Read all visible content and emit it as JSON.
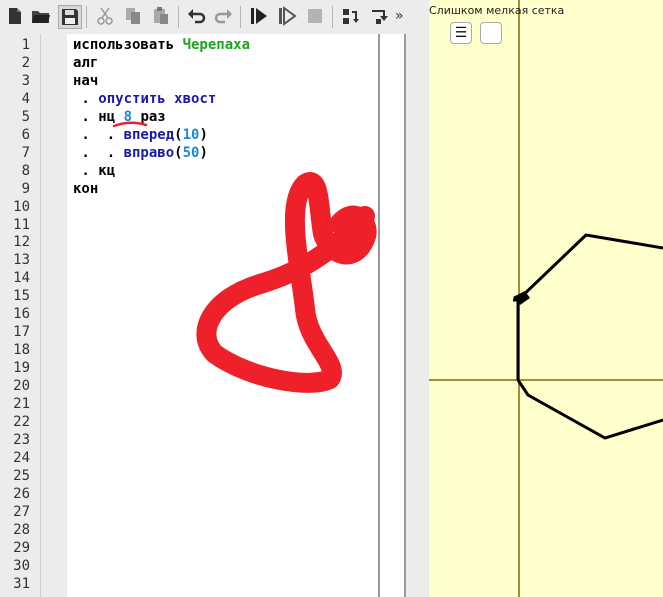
{
  "toolbar": {
    "buttons": [
      {
        "name": "new-file-icon"
      },
      {
        "name": "open-folder-icon"
      },
      {
        "name": "save-icon"
      },
      {
        "name": "cut-icon"
      },
      {
        "name": "copy-icon"
      },
      {
        "name": "paste-icon"
      },
      {
        "name": "undo-icon"
      },
      {
        "name": "redo-icon"
      },
      {
        "name": "run-icon"
      },
      {
        "name": "step-run-icon"
      },
      {
        "name": "stop-icon"
      },
      {
        "name": "step-into-icon"
      },
      {
        "name": "step-over-icon"
      }
    ],
    "more": "»"
  },
  "editor": {
    "line_numbers": [
      "1",
      "2",
      "3",
      "4",
      "5",
      "6",
      "7",
      "8",
      "9",
      "10",
      "11",
      "12",
      "13",
      "14",
      "15",
      "16",
      "17",
      "18",
      "19",
      "20",
      "21",
      "22",
      "23",
      "24",
      "25",
      "26",
      "27",
      "28",
      "29",
      "30",
      "31"
    ],
    "lines": [
      [
        {
          "t": "использовать ",
          "c": "kw"
        },
        {
          "t": "Черепаха",
          "c": "gr"
        }
      ],
      [
        {
          "t": "алг",
          "c": "kw"
        }
      ],
      [
        {
          "t": "нач",
          "c": "kw"
        }
      ],
      [
        {
          "t": " . ",
          "c": "kw"
        },
        {
          "t": "опустить хвост",
          "c": "bl"
        }
      ],
      [
        {
          "t": " . нц ",
          "c": "kw"
        },
        {
          "t": "8",
          "c": "nm"
        },
        {
          "t": " раз",
          "c": "kw"
        }
      ],
      [
        {
          "t": " .  . ",
          "c": "kw"
        },
        {
          "t": "вперед",
          "c": "bl"
        },
        {
          "t": "(",
          "c": "kw"
        },
        {
          "t": "10",
          "c": "nm"
        },
        {
          "t": ")",
          "c": "kw"
        }
      ],
      [
        {
          "t": " .  . ",
          "c": "kw"
        },
        {
          "t": "вправо",
          "c": "bl"
        },
        {
          "t": "(",
          "c": "kw"
        },
        {
          "t": "50",
          "c": "nm"
        },
        {
          "t": ")",
          "c": "kw"
        }
      ],
      [
        {
          "t": " . кц",
          "c": "kw"
        }
      ],
      [
        {
          "t": "кон",
          "c": "kw"
        }
      ]
    ]
  },
  "canvas": {
    "warning": "Слишком мелкая сетка",
    "menu_glyph": "☰"
  },
  "colors": {
    "canvas_bg": "#ffffcc",
    "axis": "#8b6508",
    "annotation": "#ee2029"
  }
}
